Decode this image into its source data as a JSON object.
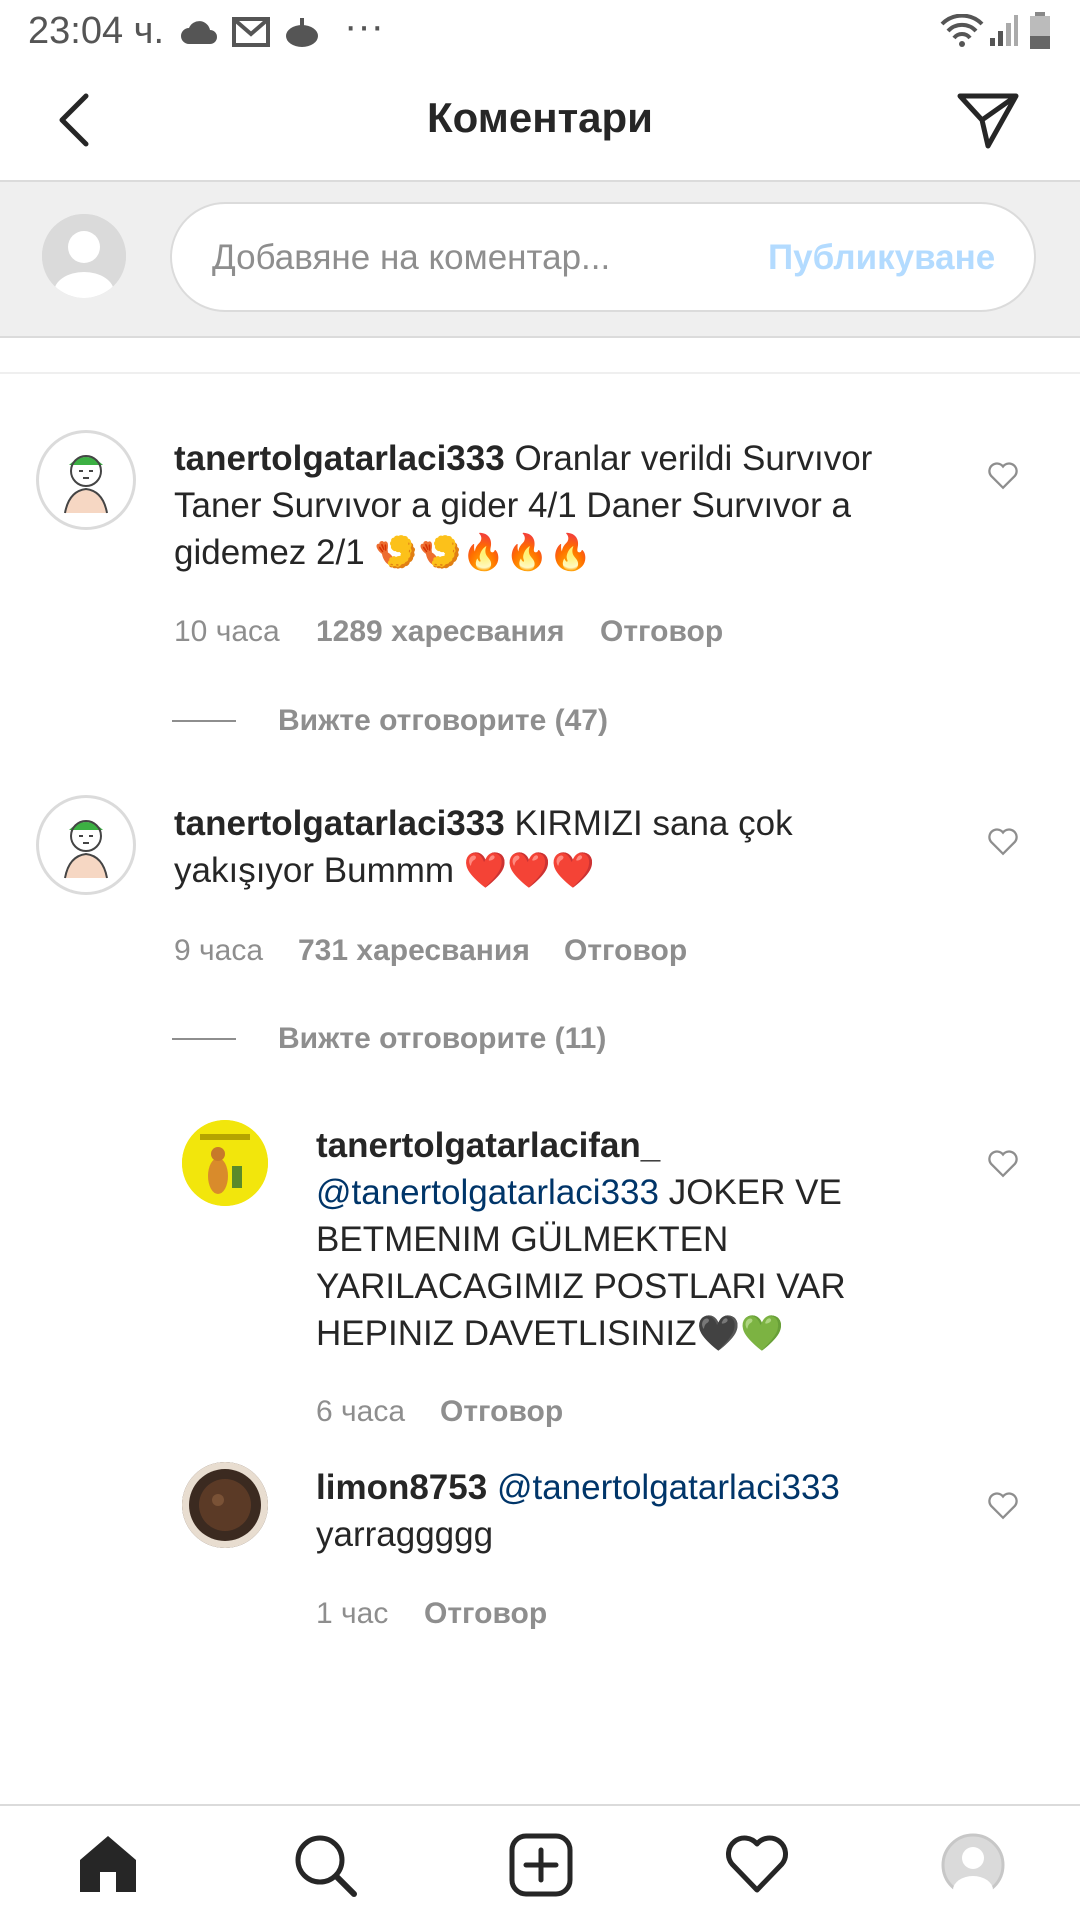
{
  "status_bar": {
    "time": "23:04 ч.",
    "more": "···"
  },
  "header": {
    "title": "Коментари"
  },
  "composer": {
    "placeholder": "Добавяне на коментар...",
    "publish_label": "Публикуване"
  },
  "comments": [
    {
      "username": "tanertolgatarlaci333",
      "text": "Oranlar verildi Survıvor Taner Survıvor a gider 4/1 Daner Survıvor a gidemez 2/1",
      "emojis": "🍤🍤🔥🔥🔥",
      "time": "10 часа",
      "likes": "1289 харесвания",
      "reply_label": "Отговор",
      "view_replies": "Вижте отговорите (47)"
    },
    {
      "username": "tanertolgatarlaci333",
      "text": "KIRMIZI sana çok yakışıyor Bummm",
      "emojis": "❤️❤️❤️",
      "time": "9 часа",
      "likes": "731 харесвания",
      "reply_label": "Отговор",
      "view_replies": "Вижте отговорите (11)"
    }
  ],
  "replies": [
    {
      "username": "tanertolgatarlacifan_",
      "mention": "@tanertolgatarlaci333",
      "text": "JOKER VE BETMENIM GÜLMEKTEN YARILACAGIMIZ POSTLARI VAR HEPINIZ DAVETLISINIZ",
      "emojis": "🖤💚",
      "time": "6 часа",
      "reply_label": "Отговор"
    },
    {
      "username": "limon8753",
      "mention": "@tanertolgatarlaci333",
      "text": "yarraggggg",
      "time": "1 час",
      "reply_label": "Отговор"
    }
  ],
  "nav": [
    "home-icon",
    "search-icon",
    "add-post-icon",
    "activity-heart-icon",
    "profile-icon"
  ],
  "colors": {
    "link_mention": "#003569",
    "publish_disabled": "#b3dbff",
    "meta_gray": "#8e8e8e"
  }
}
